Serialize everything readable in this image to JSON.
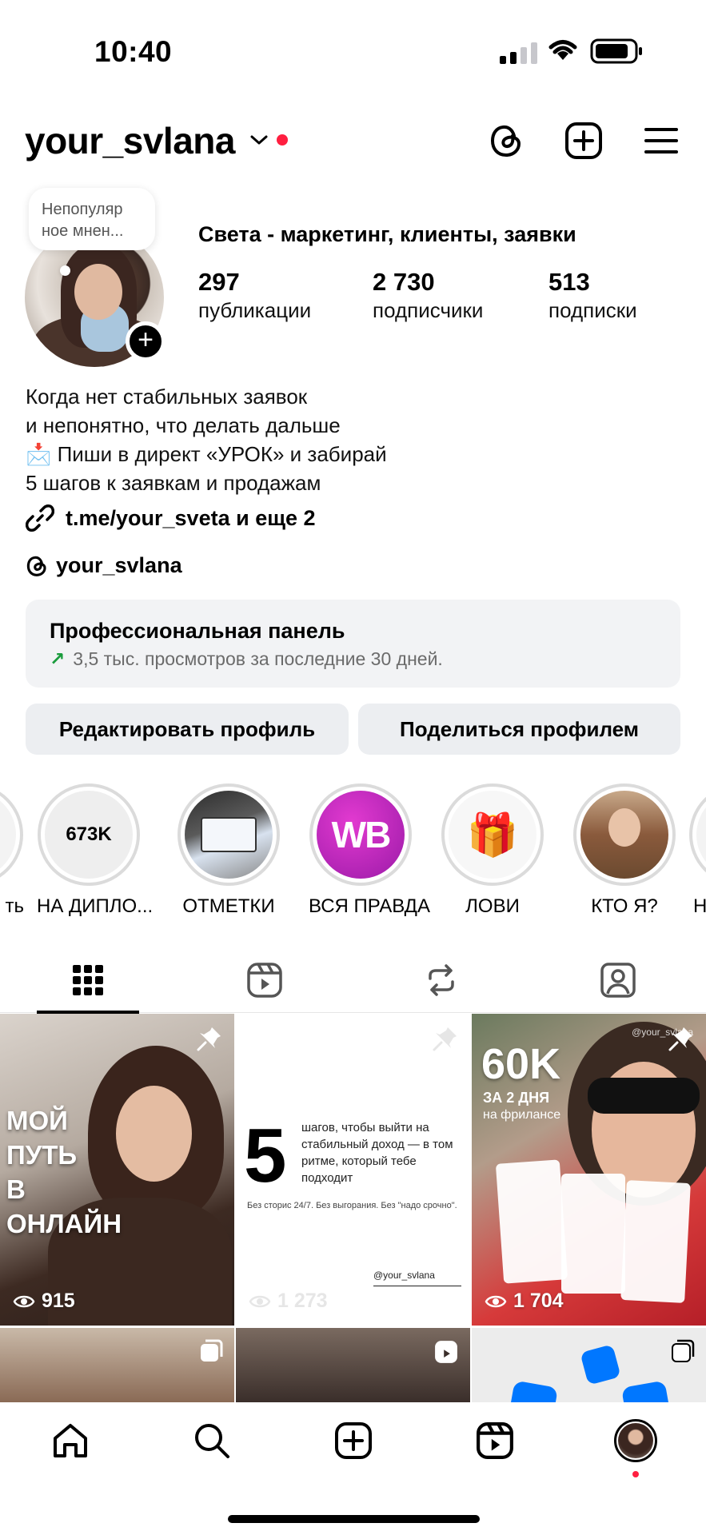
{
  "status_bar": {
    "time": "10:40"
  },
  "header": {
    "username": "your_svlana"
  },
  "profile": {
    "note": "Непопуляр ное мнен...",
    "display_name": "Света - маркетинг, клиенты, заявки",
    "stats": [
      {
        "value": "297",
        "label": "публикации"
      },
      {
        "value": "2 730",
        "label": "подписчики"
      },
      {
        "value": "513",
        "label": "подписки"
      }
    ],
    "bio": [
      "Когда нет стабильных заявок",
      "и непонятно, что делать дальше",
      "📩 Пиши в директ «УРОК» и забирай",
      "5 шагов к заявкам и продажам"
    ],
    "link": "t.me/your_sveta и еще 2",
    "threads_handle": "your_svlana"
  },
  "pro_panel": {
    "title": "Профессиональная панель",
    "subtitle": "3,5 тыс. просмотров за последние 30 дней."
  },
  "buttons": {
    "edit": "Редактировать профиль",
    "share": "Поделиться профилем"
  },
  "highlights": [
    {
      "label": "ть"
    },
    {
      "label": "НА ДИПЛО...",
      "cover_text": "673K"
    },
    {
      "label": "ОТМЕТКИ"
    },
    {
      "label": "ВСЯ ПРАВДА",
      "cover_text": "WB"
    },
    {
      "label": "ЛОВИ"
    },
    {
      "label": "КТО Я?"
    },
    {
      "label": "Н"
    }
  ],
  "posts": [
    {
      "overlay_text": [
        "МОЙ",
        "ПУТЬ",
        "В",
        "ОНЛАЙН"
      ],
      "views": "915"
    },
    {
      "big_number": "5",
      "headline": "шагов, чтобы выйти на стабильный доход — в том ритме, который тебе подходит",
      "sub": "Без сторис 24/7. Без выгорания. Без \"надо срочно\".",
      "handle": "@your_svlana",
      "views": "1 273"
    },
    {
      "big": "60K",
      "line2": "ЗА 2 ДНЯ",
      "line3": "на фрилансе",
      "handle": "@your_svlana",
      "views": "1 704"
    }
  ],
  "colors": {
    "accent_red": "#ff1f40",
    "panel_bg": "#f2f3f5",
    "button_bg": "#eceef1",
    "trend_green": "#1a9c3c",
    "wb_purple": "#c21fb5"
  }
}
